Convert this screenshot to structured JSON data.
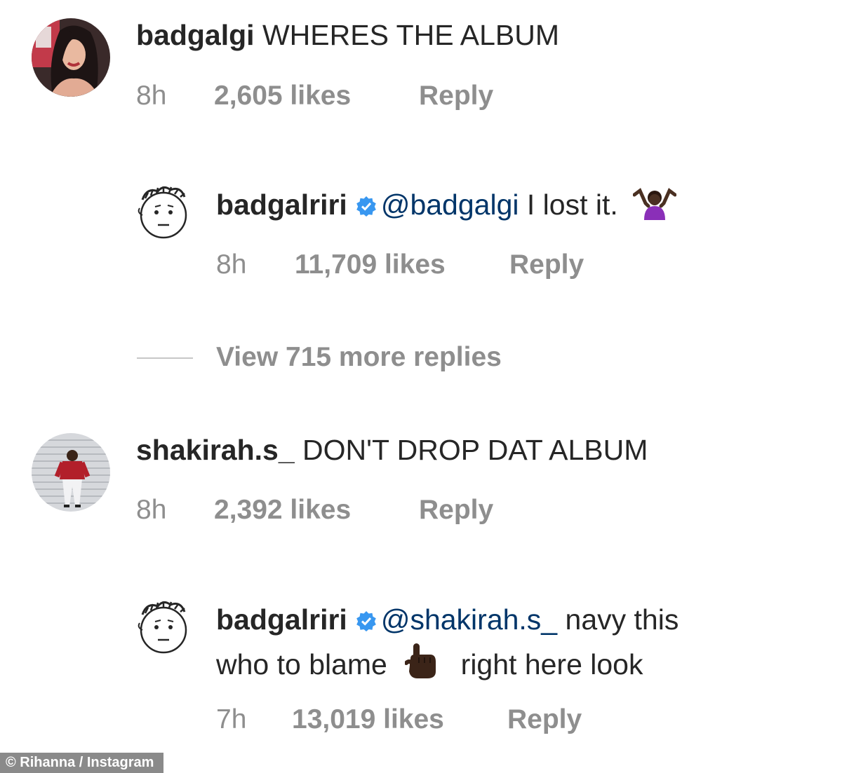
{
  "comments": [
    {
      "username": "badgalgi",
      "text": "WHERES THE ALBUM",
      "time": "8h",
      "likes": "2,605 likes",
      "reply": "Reply",
      "avatar_icon": "woman-photo-avatar"
    },
    {
      "username": "badgalriri",
      "verified_icon": "verified-badge-icon",
      "mention": "@badgalgi",
      "text": "I lost it.",
      "emoji_icon": "woman-shrugging-emoji",
      "time": "8h",
      "likes": "11,709 likes",
      "reply": "Reply",
      "avatar_icon": "doodle-face-avatar"
    },
    {
      "view_more": "View 715 more replies"
    },
    {
      "username": "shakirah.s_",
      "text": "DON'T DROP DAT ALBUM",
      "time": "8h",
      "likes": "2,392 likes",
      "reply": "Reply",
      "avatar_icon": "person-photo-avatar"
    },
    {
      "username": "badgalriri",
      "verified_icon": "verified-badge-icon",
      "mention": "@shakirah.s_",
      "text_line1": "navy this",
      "text_line2a": "who to blame",
      "emoji_icon": "pointing-up-emoji",
      "text_line2b": "right here look",
      "time": "7h",
      "likes": "13,019 likes",
      "reply": "Reply",
      "avatar_icon": "doodle-face-avatar"
    }
  ],
  "credit": "© Rihanna / Instagram",
  "colors": {
    "text": "#262626",
    "meta": "#8e8e8e",
    "mention": "#003569",
    "verified": "#3897f0",
    "emoji_purple": "#8a2fb8",
    "emoji_skin": "#4a3022"
  }
}
